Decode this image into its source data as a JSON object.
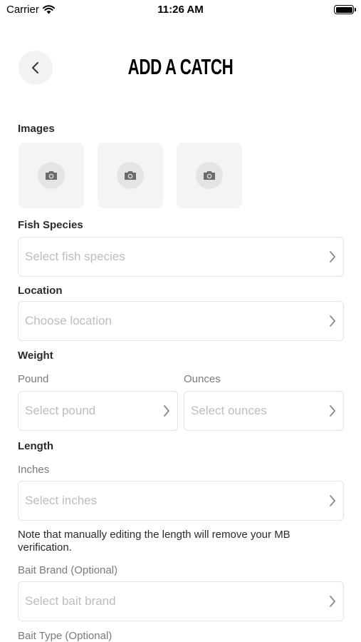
{
  "status_bar": {
    "carrier": "Carrier",
    "time": "11:26 AM"
  },
  "header": {
    "title": "ADD A CATCH"
  },
  "images": {
    "label": "Images",
    "slot_count": 3
  },
  "fish_species": {
    "label": "Fish Species",
    "placeholder": "Select fish species"
  },
  "location": {
    "label": "Location",
    "placeholder": "Choose location"
  },
  "weight": {
    "label": "Weight",
    "pound": {
      "label": "Pound",
      "placeholder": "Select pound"
    },
    "ounces": {
      "label": "Ounces",
      "placeholder": "Select ounces"
    }
  },
  "length": {
    "label": "Length",
    "inches": {
      "label": "Inches",
      "placeholder": "Select inches"
    },
    "note": "Note that manually editing the length will remove your MB verification."
  },
  "bait_brand": {
    "label": "Bait Brand (Optional)",
    "placeholder": "Select bait brand"
  },
  "bait_type": {
    "label": "Bait Type (Optional)"
  },
  "icons": {
    "wifi": "wifi-icon",
    "battery": "battery-icon",
    "back": "chevron-left-icon",
    "camera": "camera-icon",
    "chevron": "chevron-right-icon"
  }
}
